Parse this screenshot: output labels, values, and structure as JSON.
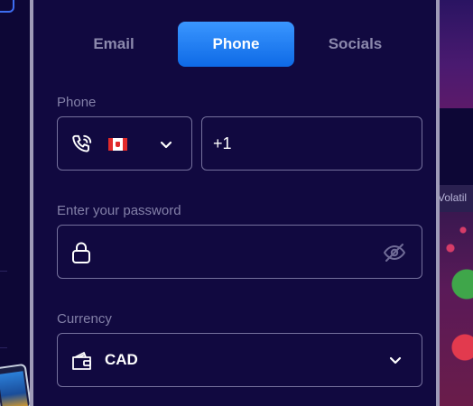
{
  "tabs": [
    {
      "label": "Email",
      "active": false
    },
    {
      "label": "Phone",
      "active": true
    },
    {
      "label": "Socials",
      "active": false
    }
  ],
  "phone": {
    "label": "Phone",
    "country_flag": "canada-flag",
    "value": "+1"
  },
  "password": {
    "label": "Enter your password",
    "value": ""
  },
  "currency": {
    "label": "Currency",
    "value": "CAD"
  },
  "background": {
    "right_banner_text": "Volatil"
  },
  "colors": {
    "accent": "#1f7cf3",
    "panel": "#110940",
    "border": "#75719d",
    "label": "#8380a8"
  }
}
